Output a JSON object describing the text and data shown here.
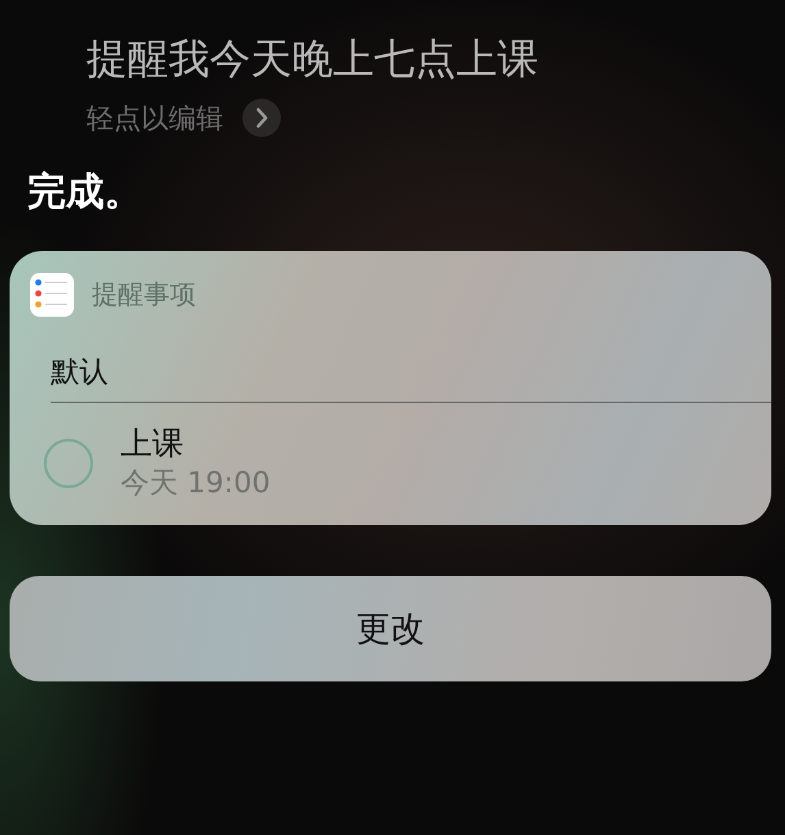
{
  "query": {
    "text": "提醒我今天晚上七点上课",
    "hint": "轻点以编辑"
  },
  "response": "完成。",
  "card": {
    "app_name": "提醒事项",
    "list_name": "默认",
    "reminders": [
      {
        "title": "上课",
        "due": "今天 19:00",
        "checked": false
      }
    ]
  },
  "buttons": [
    "更改"
  ]
}
